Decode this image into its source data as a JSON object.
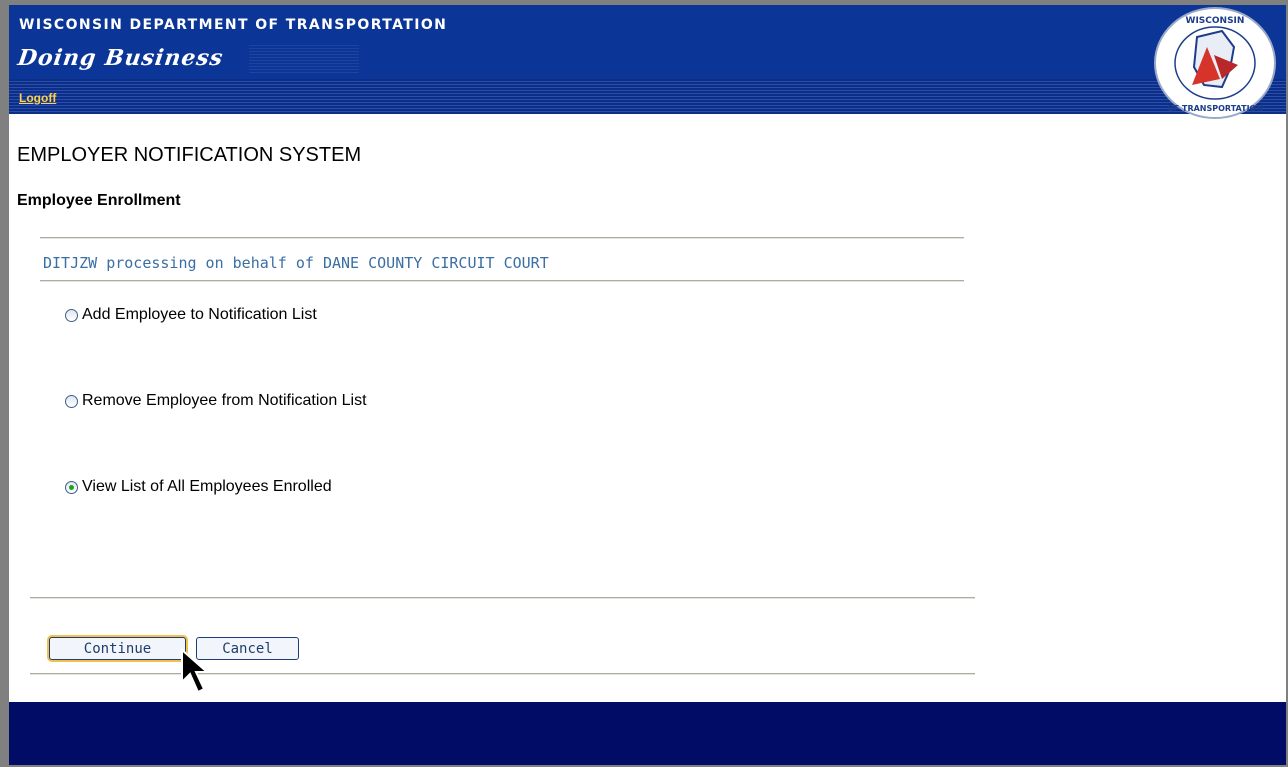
{
  "header": {
    "dept_title": "WISCONSIN DEPARTMENT OF TRANSPORTATION",
    "brand": "Doing Business",
    "logoff": "Logoff",
    "seal_icon": "wisconsin-dot-seal-icon"
  },
  "main": {
    "page_title": "EMPLOYER NOTIFICATION SYSTEM",
    "subtitle": "Employee Enrollment",
    "processing_text": "DITJZW processing on behalf of DANE COUNTY CIRCUIT COURT",
    "options": [
      {
        "label": "Add Employee to Notification List",
        "checked": false
      },
      {
        "label": "Remove Employee from Notification List",
        "checked": false
      },
      {
        "label": "View List of All Employees Enrolled",
        "checked": true
      }
    ],
    "continue_label": "Continue",
    "cancel_label": "Cancel"
  },
  "colors": {
    "header_blue": "#0b3596",
    "footer_navy": "#000c66",
    "logoff_yellow": "#ffd24a",
    "processing_blue": "#3a6ea5"
  }
}
